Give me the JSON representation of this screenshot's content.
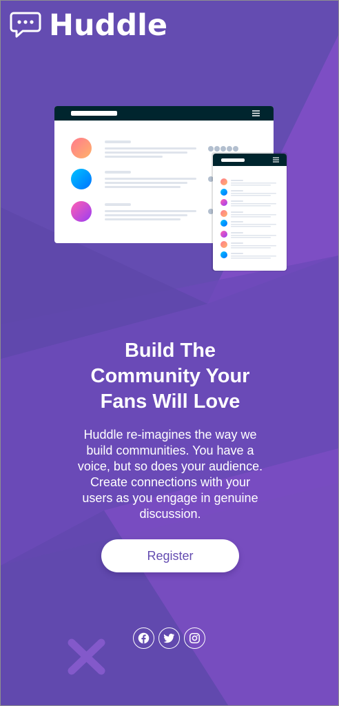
{
  "brand": {
    "name": "Huddle",
    "logo_icon": "chat-bubble-icon"
  },
  "hero": {
    "headline_lines": [
      "Build The",
      "Community Your",
      "Fans Will Love"
    ],
    "description": "Huddle re-imagines the way we build communities. You have a voice, but so does your audience. Create connections with your users as you engage in genuine discussion.",
    "register_label": "Register"
  },
  "social": [
    {
      "name": "facebook",
      "icon": "facebook-icon"
    },
    {
      "name": "twitter",
      "icon": "twitter-icon"
    },
    {
      "name": "instagram",
      "icon": "instagram-icon"
    }
  ],
  "colors": {
    "background": "#634bb0",
    "accent_dark": "#00252e",
    "text": "#ffffff",
    "button_text": "#634bb0"
  }
}
